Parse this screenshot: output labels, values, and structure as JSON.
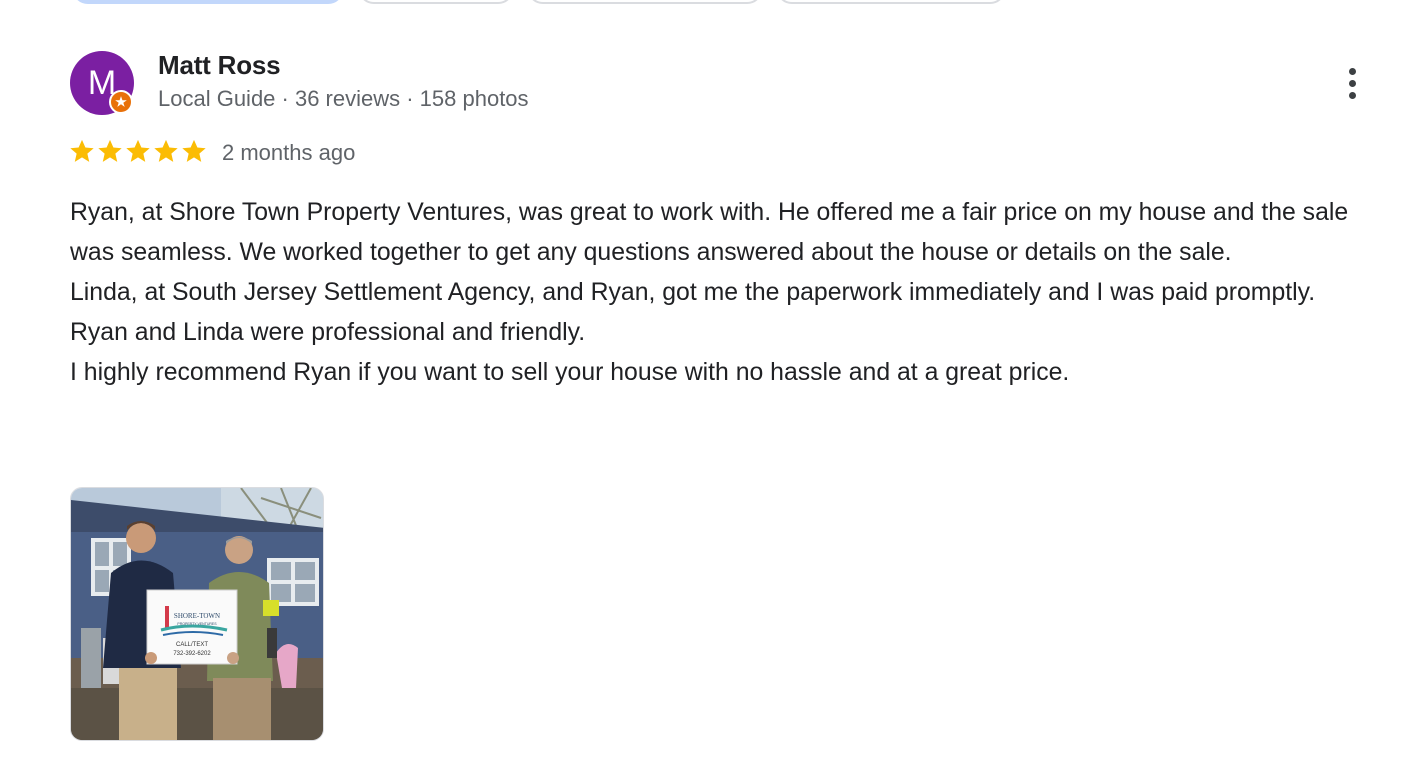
{
  "reviewer": {
    "avatar_initial": "M",
    "name": "Matt Ross",
    "meta": "Local Guide · 36 reviews · 158 photos"
  },
  "review": {
    "rating": 5,
    "date": "2 months ago",
    "paragraphs": [
      "Ryan, at Shore Town Property Ventures, was great to work with. He offered me a fair price on my house and the sale was seamless. We worked together to get any questions answered about the house or details on the sale.",
      "Linda, at South Jersey Settlement Agency, and Ryan, got me the paperwork immediately and I was paid promptly.",
      "Ryan and Linda were professional and friendly.",
      "I highly recommend Ryan if you want to sell your house with no hassle and at a great price."
    ],
    "photo": {
      "sign_title": "SHORE-TOWN",
      "sign_sub": "PROPERTY VENTURES",
      "sign_call": "CALL/TEXT",
      "sign_phone": "732-392-6202"
    }
  },
  "icons": {
    "more": "more-vert-icon",
    "star": "star-icon",
    "badge": "local-guide-badge-icon"
  },
  "colors": {
    "avatar_bg": "#7b1fa2",
    "star": "#fbbc04",
    "badge": "#e8710a",
    "secondary_text": "#5f6368"
  }
}
